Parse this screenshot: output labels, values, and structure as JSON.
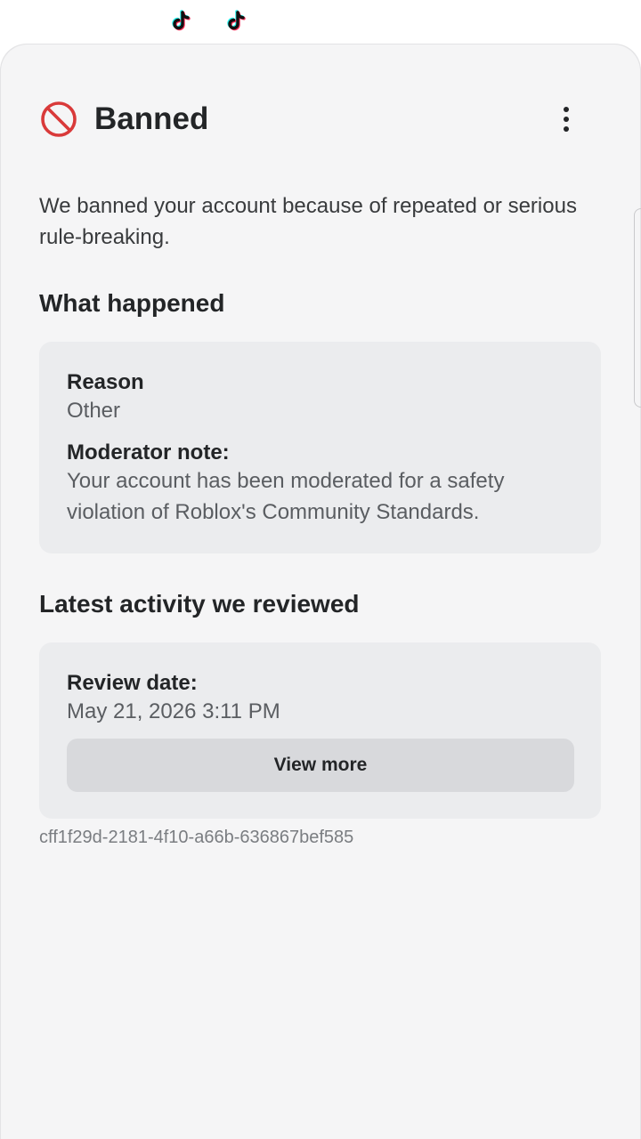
{
  "status_bar": {
    "icons": [
      "tiktok-icon",
      "tiktok-icon"
    ]
  },
  "header": {
    "title": "Banned",
    "status_icon": "prohibited-icon",
    "menu_icon": "more-vertical-icon"
  },
  "intro_text": "We banned your account because of repeated or serious rule-breaking.",
  "what_happened": {
    "heading": "What happened",
    "reason_label": "Reason",
    "reason_value": "Other",
    "note_label": "Moderator note:",
    "note_value": "Your account has been moderated for a safety violation of Roblox's Community Standards."
  },
  "latest_activity": {
    "heading": "Latest activity we reviewed",
    "date_label": "Review date:",
    "date_value": "May 21, 2026 3:11 PM",
    "button_label": "View more"
  },
  "trace_id": "cff1f29d-2181-4f10-a66b-636867bef585",
  "colors": {
    "ban_red": "#d93a3a",
    "card_bg": "#ebecee",
    "sheet_bg": "#f5f5f6",
    "tiktok_cyan": "#25f4ee",
    "tiktok_pink": "#fe2c55"
  }
}
